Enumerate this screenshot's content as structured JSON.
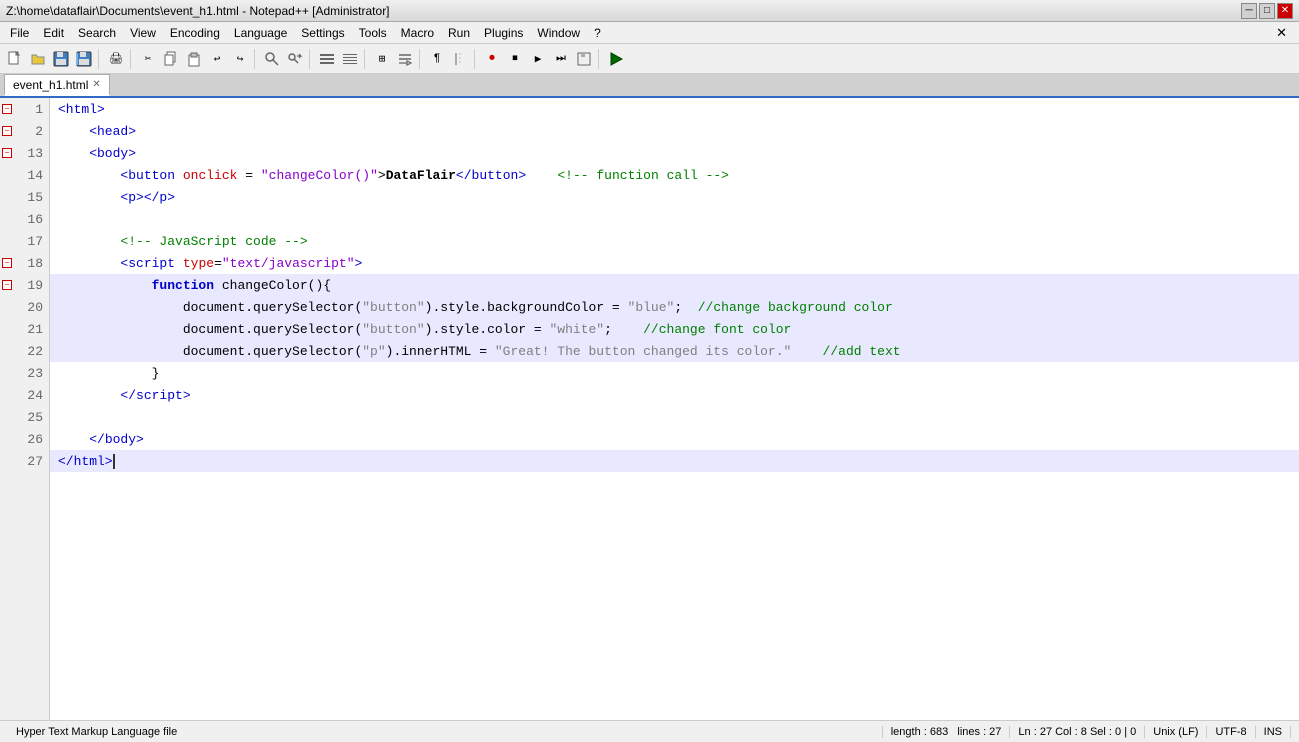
{
  "window": {
    "title": "Z:\\home\\dataflair\\Documents\\event_h1.html - Notepad++ [Administrator]",
    "close_x": "✕"
  },
  "menu": {
    "items": [
      "File",
      "Edit",
      "Search",
      "View",
      "Encoding",
      "Language",
      "Settings",
      "Tools",
      "Macro",
      "Run",
      "Plugins",
      "Window",
      "?"
    ]
  },
  "tabs": [
    {
      "label": "event_h1.html",
      "active": true
    }
  ],
  "code_lines": [
    {
      "num": "1",
      "fold": true,
      "content_html": "<span class='c-tag'>&lt;html&gt;</span>",
      "highlighted": false
    },
    {
      "num": "2",
      "fold": true,
      "content_html": "&nbsp;&nbsp;&nbsp;&nbsp;<span class='c-tag'>&lt;head&gt;</span>",
      "highlighted": false
    },
    {
      "num": "13",
      "fold": true,
      "content_html": "&nbsp;&nbsp;&nbsp;&nbsp;<span class='c-tag'>&lt;body&gt;</span>",
      "highlighted": false
    },
    {
      "num": "14",
      "fold": false,
      "content_html": "&nbsp;&nbsp;&nbsp;&nbsp;&nbsp;&nbsp;&nbsp;&nbsp;<span class='c-tag'>&lt;button</span> <span class='c-attr'>onclick</span> = <span class='c-val'>&ldquo;changeColor()&rdquo;</span>&gt;<span class='c-bold'>DataFlair</span><span class='c-tag'>&lt;/button&gt;</span>&nbsp;&nbsp;&nbsp;&nbsp;<span class='c-comment'>&lt;!-- function call --&gt;</span>",
      "highlighted": false
    },
    {
      "num": "15",
      "fold": false,
      "content_html": "&nbsp;&nbsp;&nbsp;&nbsp;&nbsp;&nbsp;&nbsp;&nbsp;<span class='c-tag'>&lt;p&gt;&lt;/p&gt;</span>",
      "highlighted": false
    },
    {
      "num": "16",
      "fold": false,
      "content_html": "",
      "highlighted": false
    },
    {
      "num": "17",
      "fold": false,
      "content_html": "&nbsp;&nbsp;&nbsp;&nbsp;&nbsp;&nbsp;&nbsp;&nbsp;<span class='c-comment'>&lt;!-- JavaScript code --&gt;</span>",
      "highlighted": false
    },
    {
      "num": "18",
      "fold": true,
      "content_html": "&nbsp;&nbsp;&nbsp;&nbsp;&nbsp;&nbsp;&nbsp;&nbsp;<span class='c-tag'>&lt;script</span> <span class='c-attr'>type</span>=<span class='c-val'>&ldquo;text/javascript&rdquo;</span>&gt;",
      "highlighted": false
    },
    {
      "num": "19",
      "fold": true,
      "content_html": "&nbsp;&nbsp;&nbsp;&nbsp;&nbsp;&nbsp;&nbsp;&nbsp;&nbsp;&nbsp;&nbsp;&nbsp;<span class='c-keyword'>function</span> changeColor(){",
      "highlighted": true
    },
    {
      "num": "20",
      "fold": false,
      "content_html": "&nbsp;&nbsp;&nbsp;&nbsp;&nbsp;&nbsp;&nbsp;&nbsp;&nbsp;&nbsp;&nbsp;&nbsp;&nbsp;&nbsp;&nbsp;&nbsp;document.querySelector(<span class='c-string'>&ldquo;button&rdquo;</span>).style.backgroundColor = <span class='c-string'>&ldquo;blue&rdquo;</span>;&nbsp;&nbsp;<span class='c-comment'>//change background color</span>",
      "highlighted": true
    },
    {
      "num": "21",
      "fold": false,
      "content_html": "&nbsp;&nbsp;&nbsp;&nbsp;&nbsp;&nbsp;&nbsp;&nbsp;&nbsp;&nbsp;&nbsp;&nbsp;&nbsp;&nbsp;&nbsp;&nbsp;document.querySelector(<span class='c-string'>&ldquo;button&rdquo;</span>).style.color = <span class='c-string'>&ldquo;white&rdquo;</span>;&nbsp;&nbsp;&nbsp;&nbsp;<span class='c-comment'>//change font color</span>",
      "highlighted": true
    },
    {
      "num": "22",
      "fold": false,
      "content_html": "&nbsp;&nbsp;&nbsp;&nbsp;&nbsp;&nbsp;&nbsp;&nbsp;&nbsp;&nbsp;&nbsp;&nbsp;&nbsp;&nbsp;&nbsp;&nbsp;document.querySelector(<span class='c-string'>&ldquo;p&rdquo;</span>).innerHTML = <span class='c-string'>&ldquo;Great! The button changed its color.&rdquo;</span>&nbsp;&nbsp;&nbsp;&nbsp;<span class='c-comment'>//add text</span>",
      "highlighted": true
    },
    {
      "num": "23",
      "fold": false,
      "content_html": "&nbsp;&nbsp;&nbsp;&nbsp;&nbsp;&nbsp;&nbsp;&nbsp;&nbsp;&nbsp;&nbsp;&nbsp;}",
      "highlighted": false
    },
    {
      "num": "24",
      "fold": false,
      "content_html": "&nbsp;&nbsp;&nbsp;&nbsp;&nbsp;&nbsp;&nbsp;&nbsp;<span class='c-tag'>&lt;/script&gt;</span>",
      "highlighted": false
    },
    {
      "num": "25",
      "fold": false,
      "content_html": "",
      "highlighted": false
    },
    {
      "num": "26",
      "fold": false,
      "content_html": "&nbsp;&nbsp;&nbsp;&nbsp;<span class='c-tag'>&lt;/body&gt;</span>",
      "highlighted": false
    },
    {
      "num": "27",
      "fold": false,
      "content_html": "<span class='c-tag'>&lt;/html&gt;</span>",
      "highlighted": true,
      "cursor": true
    }
  ],
  "status": {
    "file_type": "Hyper Text Markup Language file",
    "length": "length : 683",
    "lines": "lines : 27",
    "position": "Ln : 27   Col : 8   Sel : 0 | 0",
    "line_ending": "Unix (LF)",
    "encoding": "UTF-8",
    "ins": "INS"
  },
  "toolbar_buttons": [
    "📄",
    "📁",
    "💾",
    "✕",
    "🖨",
    "🔍",
    "✂",
    "📋",
    "📋",
    "↩",
    "↪",
    "🔍",
    "🔍",
    "✂",
    "✂",
    "🔲",
    "🔲",
    "⊞",
    "⊞",
    "📌",
    "🔴",
    "⏹",
    "▶",
    "⏭",
    "⏹",
    "💡"
  ]
}
